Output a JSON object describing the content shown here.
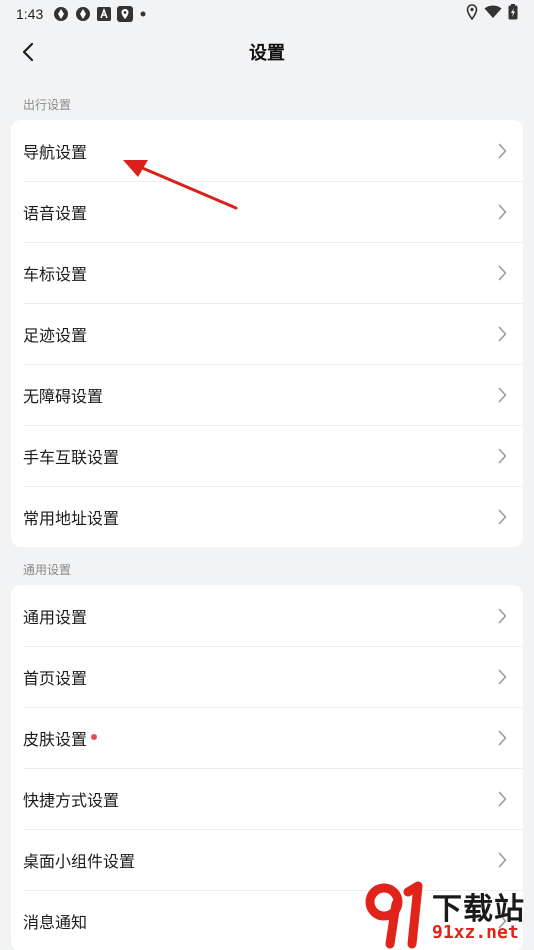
{
  "status_bar": {
    "time": "1:43",
    "icons_left": [
      "aperture-icon",
      "aperture-icon",
      "app-a-icon",
      "map-pin-app-icon",
      "dot-icon"
    ],
    "icons_right": [
      "location-icon",
      "wifi-icon",
      "battery-charging-icon"
    ]
  },
  "header": {
    "title": "设置"
  },
  "sections": [
    {
      "label": "出行设置",
      "items": [
        {
          "label": "导航设置"
        },
        {
          "label": "语音设置"
        },
        {
          "label": "车标设置"
        },
        {
          "label": "足迹设置"
        },
        {
          "label": "无障碍设置"
        },
        {
          "label": "手车互联设置"
        },
        {
          "label": "常用地址设置"
        }
      ]
    },
    {
      "label": "通用设置",
      "items": [
        {
          "label": "通用设置"
        },
        {
          "label": "首页设置"
        },
        {
          "label": "皮肤设置",
          "badge": "red-dot"
        },
        {
          "label": "快捷方式设置"
        },
        {
          "label": "桌面小组件设置"
        },
        {
          "label": "消息通知"
        }
      ]
    }
  ],
  "watermark": {
    "main": "下载站",
    "url": "91xz.net"
  },
  "colors": {
    "background": "#f2f3f5",
    "card": "#ffffff",
    "badge_dot": "#ef4b4b",
    "annotation_arrow": "#d9221c",
    "watermark_red": "#e2231a"
  }
}
